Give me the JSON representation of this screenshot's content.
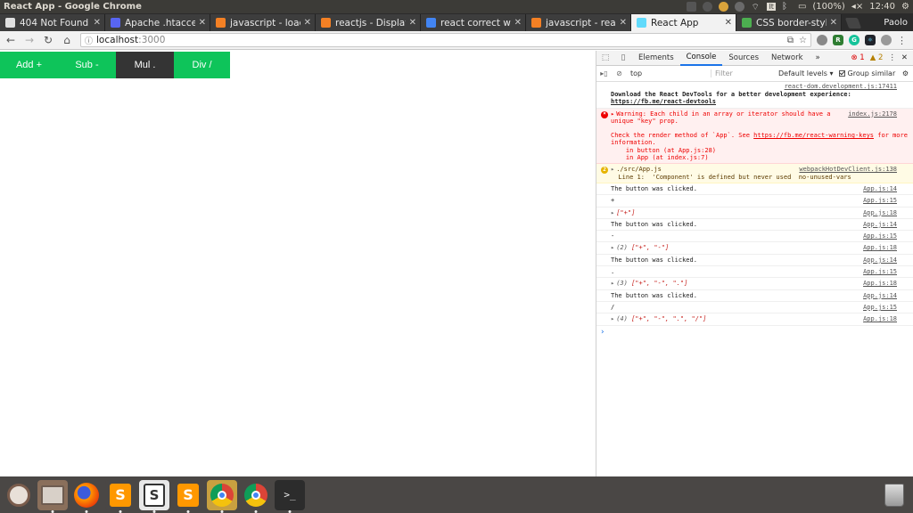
{
  "top_panel": {
    "window_title": "React App - Google Chrome",
    "battery": "(100%)",
    "time": "12:40",
    "keyboard": "It"
  },
  "tabs": [
    {
      "title": "404 Not Found",
      "favicon_color": "#e0e0e0",
      "favicon": "doc-icon"
    },
    {
      "title": "Apache .htaccess r",
      "favicon_color": "#5865f2",
      "favicon": "github-icon"
    },
    {
      "title": "javascript - loading",
      "favicon_color": "#f48024",
      "favicon": "stackoverflow-icon"
    },
    {
      "title": "reactjs - Display co",
      "favicon_color": "#f48024",
      "favicon": "stackoverflow-icon"
    },
    {
      "title": "react correct way t",
      "favicon_color": "#4285f4",
      "favicon": "google-icon"
    },
    {
      "title": "javascript - react n",
      "favicon_color": "#f48024",
      "favicon": "stackoverflow-icon"
    },
    {
      "title": "React App",
      "favicon_color": "#61dafb",
      "favicon": "react-icon",
      "active": true
    },
    {
      "title": "CSS border-style p",
      "favicon_color": "#4caf50",
      "favicon": "w3-icon"
    }
  ],
  "profile_name": "Paolo",
  "address": {
    "host": "localhost",
    "port": ":3000"
  },
  "buttons": [
    {
      "label": "Add +",
      "color": "#0ec45a"
    },
    {
      "label": "Sub -",
      "color": "#0ec45a"
    },
    {
      "label": "Mul .",
      "color": "#343434"
    },
    {
      "label": "Div /",
      "color": "#0ec45a"
    }
  ],
  "devtools": {
    "tabs": [
      "Elements",
      "Console",
      "Sources",
      "Network"
    ],
    "active_tab": "Console",
    "error_count": "1",
    "warning_count": "2",
    "context": "top",
    "filter_placeholder": "Filter",
    "levels": "Default levels ▾",
    "group_similar": "Group similar",
    "messages": {
      "devtools_src": "react-dom.development.js:17411",
      "devtools_line1": "Download the React DevTools for a better development experience: ",
      "devtools_link": "https://fb.me/react-devtools",
      "warning_key_src": "index.js:2178",
      "warning_key_line": "Warning: Each child in an array or iterator should have a unique \"key\" prop.",
      "warning_key_check": "Check the render method of `App`. See ",
      "warning_key_link": "https://fb.me/react-warning-keys",
      "warning_key_more": " for more information.",
      "warning_key_stack1": "    in button (at App.js:28)",
      "warning_key_stack2": "    in App (at index.js:7)",
      "lint_badge": "2",
      "lint_src": "webpackHotDevClient.js:138",
      "lint_file": "./src/App.js",
      "lint_line": "  Line 1:  'Component' is defined but never used  no-unused-vars",
      "log_clicked": "The button was clicked.",
      "src14": "App.js:14",
      "src15": "App.js:15",
      "src18": "App.js:18",
      "val_plus": "+",
      "val_minus": "-",
      "val_dot": ".",
      "val_slash": "/",
      "arr1": "[\"+\"]",
      "arr2_count": "(2)",
      "arr2": "[\"+\", \"-\"]",
      "arr3_count": "(3)",
      "arr3": "[\"+\", \"-\", \".\"]",
      "arr4_count": "(4)",
      "arr4": "[\"+\", \"-\", \".\", \"/\"]"
    }
  },
  "dock": [
    {
      "name": "ubuntu-icon",
      "color": "#7a5c4c"
    },
    {
      "name": "files-icon",
      "color": "#8a6f5b"
    },
    {
      "name": "firefox-icon",
      "color": "#e66000"
    },
    {
      "name": "sublime-icon",
      "color": "#4a4745"
    },
    {
      "name": "slack-icon",
      "color": "#e8e8e8"
    },
    {
      "name": "sublime-icon",
      "color": "#4a4745"
    },
    {
      "name": "chrome-icon",
      "color": "#c8a040"
    },
    {
      "name": "chrome-icon",
      "color": "#4a4745"
    },
    {
      "name": "terminal-icon",
      "color": "#2c2c2c"
    }
  ]
}
